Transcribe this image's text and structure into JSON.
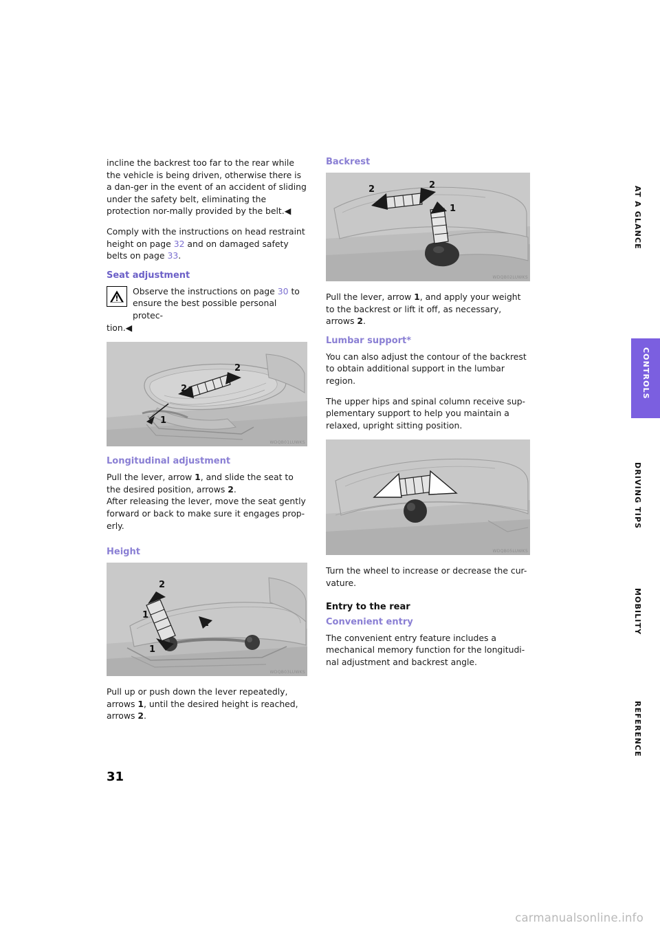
{
  "document": {
    "page_number": "31",
    "watermark": "carmanualsonline.info"
  },
  "side_tabs": [
    {
      "label": "AT A GLANCE",
      "active": false
    },
    {
      "label": "CONTROLS",
      "active": true
    },
    {
      "label": "DRIVING TIPS",
      "active": false
    },
    {
      "label": "MOBILITY",
      "active": false
    },
    {
      "label": "REFERENCE",
      "active": false
    }
  ],
  "left_column": {
    "para_intro": "incline the backrest too far to the rear while the vehicle is being driven, otherwise there is a dan-ger in the event of an accident of sliding under the safety belt, eliminating the protection nor-mally provided by the belt.◀",
    "para_comply_1": "Comply with the instructions on head restraint height on page ",
    "para_comply_link1": "32",
    "para_comply_2": " and on damaged safety belts on page ",
    "para_comply_link2": "33",
    "para_comply_3": ".",
    "heading_seat_adjustment": "Seat adjustment",
    "warning_text_1": "Observe the instructions on page ",
    "warning_link": "30",
    "warning_text_2": " to ensure the best possible personal protec-",
    "warning_tail": "tion.◀",
    "figure_seat_longitudinal_code": "WDQB01LUWKS",
    "heading_longitudinal": "Longitudinal adjustment",
    "para_longitudinal_1_a": "Pull the lever, arrow ",
    "para_longitudinal_1_b": "1",
    "para_longitudinal_1_c": ", and slide the seat to the desired position, arrows ",
    "para_longitudinal_1_d": "2",
    "para_longitudinal_1_e": ".",
    "para_longitudinal_2": "After releasing the lever, move the seat gently forward or back to make sure it engages prop-erly.",
    "heading_height": "Height",
    "figure_height_code": "WDQB03LUWKS",
    "para_height_a": "Pull up or push down the lever repeatedly, arrows ",
    "para_height_b": "1",
    "para_height_c": ", until the desired height is reached, arrows ",
    "para_height_d": "2",
    "para_height_e": "."
  },
  "right_column": {
    "heading_backrest": "Backrest",
    "figure_backrest_code": "WDQB02LUWKS",
    "para_backrest_a": "Pull the lever, arrow ",
    "para_backrest_b": "1",
    "para_backrest_c": ", and apply your weight to the backrest or lift it off, as necessary, arrows ",
    "para_backrest_d": "2",
    "para_backrest_e": ".",
    "heading_lumbar": "Lumbar support*",
    "para_lumbar_1": "You can also adjust the contour of the backrest to obtain additional support in the lumbar region.",
    "para_lumbar_2": "The upper hips and spinal column receive sup-plementary support to help you maintain a relaxed, upright sitting position.",
    "figure_lumbar_code": "WDQB05LUWKS",
    "para_lumbar_3": "Turn the wheel to increase or decrease the cur-vature.",
    "heading_entry_rear": "Entry to the rear",
    "heading_convenient_entry": "Convenient entry",
    "para_convenient": "The convenient entry feature includes a mechanical memory function for the longitudi-nal adjustment and backrest angle."
  },
  "colors": {
    "accent_purple": "#7b5fe0",
    "heading_purple": "#8a7fd4",
    "link_purple": "#7b6fd0",
    "figure_gray": "#c8c8c8"
  }
}
